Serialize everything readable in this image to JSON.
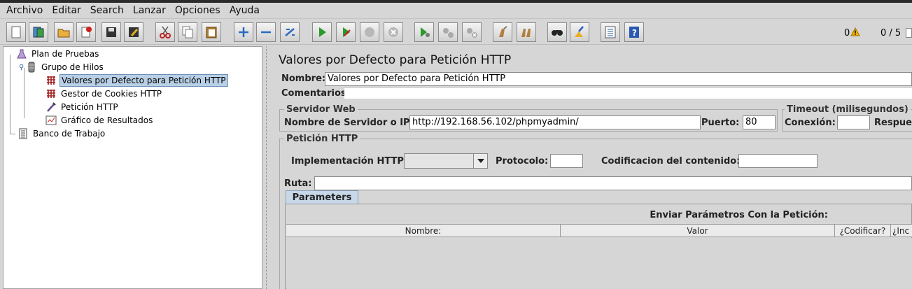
{
  "menu": [
    "Archivo",
    "Editar",
    "Search",
    "Lanzar",
    "Opciones",
    "Ayuda"
  ],
  "toolbar": {
    "errors_count": "0",
    "threads_count": "0 / 5",
    "buttons": [
      "new-icon",
      "templates-icon",
      "open-icon",
      "close-icon",
      "save-icon",
      "save-as-icon",
      "cut-icon",
      "copy-icon",
      "paste-icon",
      "expand-icon",
      "collapse-icon",
      "toggle-icon",
      "start-icon",
      "start-no-pause-icon",
      "stop-icon",
      "shutdown-icon",
      "remote-start-icon",
      "remote-stop-icon",
      "remote-shutdown-icon",
      "clear-icon",
      "clear-all-icon",
      "search-icon",
      "reset-search-icon",
      "function-helper-icon",
      "help-icon"
    ]
  },
  "tree": {
    "items": [
      {
        "label": "Plan de Pruebas",
        "icon": "test-plan-icon"
      },
      {
        "label": "Grupo de Hilos",
        "icon": "thread-group-icon"
      },
      {
        "label": "Valores por Defecto para Petición HTTP",
        "icon": "config-element-icon"
      },
      {
        "label": "Gestor de Cookies HTTP",
        "icon": "config-element-icon"
      },
      {
        "label": "Petición HTTP",
        "icon": "sampler-icon"
      },
      {
        "label": "Gráfico de Resultados",
        "icon": "graph-listener-icon"
      },
      {
        "label": "Banco de Trabajo",
        "icon": "workbench-icon"
      }
    ]
  },
  "panel": {
    "title": "Valores por Defecto para Petición HTTP",
    "name_label": "Nombre:",
    "name_value": "Valores por Defecto para Petición HTTP",
    "comments_label": "Comentarios",
    "web_server": {
      "legend": "Servidor Web",
      "server_label": "Nombre de Servidor o IP:",
      "server_value": "http://192.168.56.102/phpmyadmin/",
      "port_label": "Puerto:",
      "port_value": "80"
    },
    "timeout": {
      "legend": "Timeout (milisegundos)",
      "connect_label": "Conexión:",
      "connect_value": "",
      "response_label": "Respue"
    },
    "http_request": {
      "legend": "Petición HTTP",
      "impl_label": "Implementación HTTP:",
      "impl_value": "",
      "protocol_label": "Protocolo:",
      "protocol_value": "",
      "encoding_label": "Codificacion del contenido:",
      "encoding_value": "",
      "path_label": "Ruta:",
      "path_value": ""
    },
    "params": {
      "tab_label": "Parameters",
      "caption": "Enviar Parámetros Con la Petición:",
      "columns": [
        "Nombre:",
        "Valor",
        "¿Codificar?",
        "¿Inc"
      ]
    }
  }
}
